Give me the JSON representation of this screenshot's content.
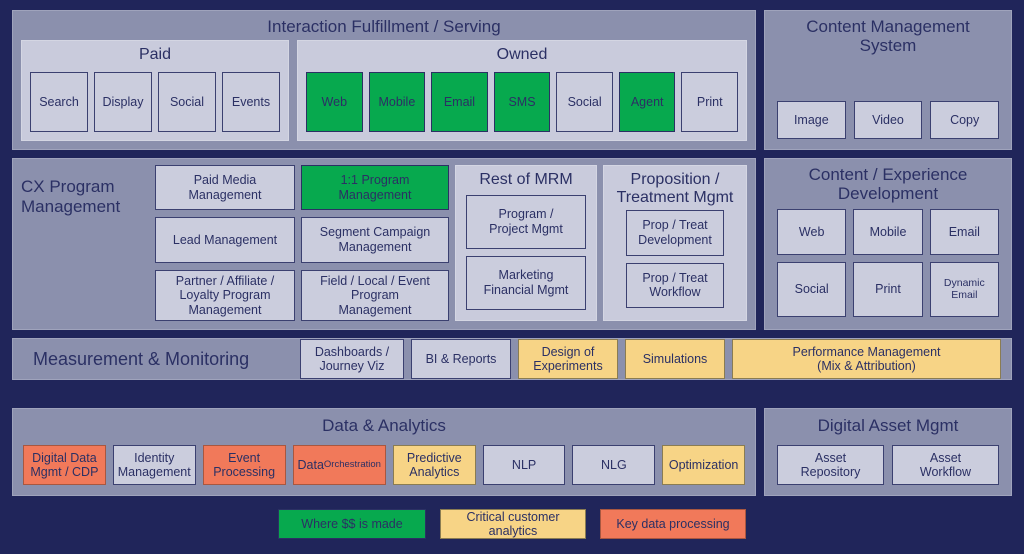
{
  "colors": {
    "background": "#20255a",
    "panel": "#8b90ad",
    "group": "#c9cbdc",
    "box": "#cbcddd",
    "box_border": "#3b4070",
    "green": "#07a94e",
    "yellow": "#f7d486",
    "orange": "#f1795a",
    "text": "#2b3064"
  },
  "interaction": {
    "title": "Interaction Fulfillment / Serving",
    "paid": {
      "title": "Paid",
      "items": [
        {
          "label": "Search",
          "style": "plain"
        },
        {
          "label": "Display",
          "style": "plain"
        },
        {
          "label": "Social",
          "style": "plain"
        },
        {
          "label": "Events",
          "style": "plain"
        }
      ]
    },
    "owned": {
      "title": "Owned",
      "items": [
        {
          "label": "Web",
          "style": "green"
        },
        {
          "label": "Mobile",
          "style": "green"
        },
        {
          "label": "Email",
          "style": "green"
        },
        {
          "label": "SMS",
          "style": "green"
        },
        {
          "label": "Social",
          "style": "plain"
        },
        {
          "label": "Agent",
          "style": "green"
        },
        {
          "label": "Print",
          "style": "plain"
        }
      ]
    }
  },
  "cms": {
    "title": "Content Management\nSystem",
    "items": [
      {
        "label": "Image",
        "style": "plain"
      },
      {
        "label": "Video",
        "style": "plain"
      },
      {
        "label": "Copy",
        "style": "plain"
      }
    ]
  },
  "cx": {
    "heading": "CX Program\nManagement",
    "column_1": [
      {
        "label": "Paid Media\nManagement",
        "style": "plain"
      },
      {
        "label": "Lead Management",
        "style": "plain"
      },
      {
        "label": "Partner / Affiliate /\nLoyalty Program\nManagement",
        "style": "plain"
      }
    ],
    "column_2": [
      {
        "label": "1:1 Program\nManagement",
        "style": "green"
      },
      {
        "label": "Segment Campaign\nManagement",
        "style": "plain"
      },
      {
        "label": "Field / Local / Event\nProgram\nManagement",
        "style": "plain"
      }
    ],
    "mrm": {
      "title": "Rest of MRM",
      "items": [
        {
          "label": "Program /\nProject Mgmt",
          "style": "plain"
        },
        {
          "label": "Marketing\nFinancial Mgmt",
          "style": "plain"
        }
      ]
    },
    "proposition": {
      "title": "Proposition /\nTreatment Mgmt",
      "items": [
        {
          "label": "Prop / Treat\nDevelopment",
          "style": "plain"
        },
        {
          "label": "Prop / Treat\nWorkflow",
          "style": "plain"
        }
      ]
    }
  },
  "content_experience": {
    "title": "Content / Experience\nDevelopment",
    "items": [
      {
        "label": "Web",
        "style": "plain",
        "sub": ""
      },
      {
        "label": "Mobile",
        "style": "plain",
        "sub": ""
      },
      {
        "label": "Email",
        "style": "plain",
        "sub": ""
      },
      {
        "label": "Social",
        "style": "plain",
        "sub": ""
      },
      {
        "label": "Print",
        "style": "plain",
        "sub": ""
      },
      {
        "label": "Dynamic\nEmail",
        "style": "plain",
        "sub": ""
      }
    ]
  },
  "measurement": {
    "heading": "Measurement & Monitoring",
    "items": [
      {
        "label": "Dashboards /\nJourney Viz",
        "style": "plain"
      },
      {
        "label": "BI & Reports",
        "style": "plain"
      },
      {
        "label": "Design of\nExperiments",
        "style": "yellow"
      },
      {
        "label": "Simulations",
        "style": "yellow"
      },
      {
        "label": "Performance Management\n(Mix & Attribution)",
        "style": "yellow"
      }
    ]
  },
  "data_analytics": {
    "title": "Data & Analytics",
    "items": [
      {
        "label": "Digital Data\nMgmt / CDP",
        "style": "orange",
        "sub": ""
      },
      {
        "label": "Identity\nManagement",
        "style": "plain",
        "sub": ""
      },
      {
        "label": "Event\nProcessing",
        "style": "orange",
        "sub": ""
      },
      {
        "label": "Data",
        "style": "orange",
        "sub": "Orchestration"
      },
      {
        "label": "Predictive\nAnalytics",
        "style": "yellow",
        "sub": ""
      },
      {
        "label": "NLP",
        "style": "plain",
        "sub": ""
      },
      {
        "label": "NLG",
        "style": "plain",
        "sub": ""
      },
      {
        "label": "Optimization",
        "style": "yellow",
        "sub": ""
      }
    ]
  },
  "digital_asset": {
    "title": "Digital Asset Mgmt",
    "items": [
      {
        "label": "Asset\nRepository",
        "style": "plain"
      },
      {
        "label": "Asset\nWorkflow",
        "style": "plain"
      }
    ]
  },
  "legend": {
    "money": "Where $$ is made",
    "critical": "Critical customer\nanalytics",
    "key_data": "Key data processing"
  }
}
